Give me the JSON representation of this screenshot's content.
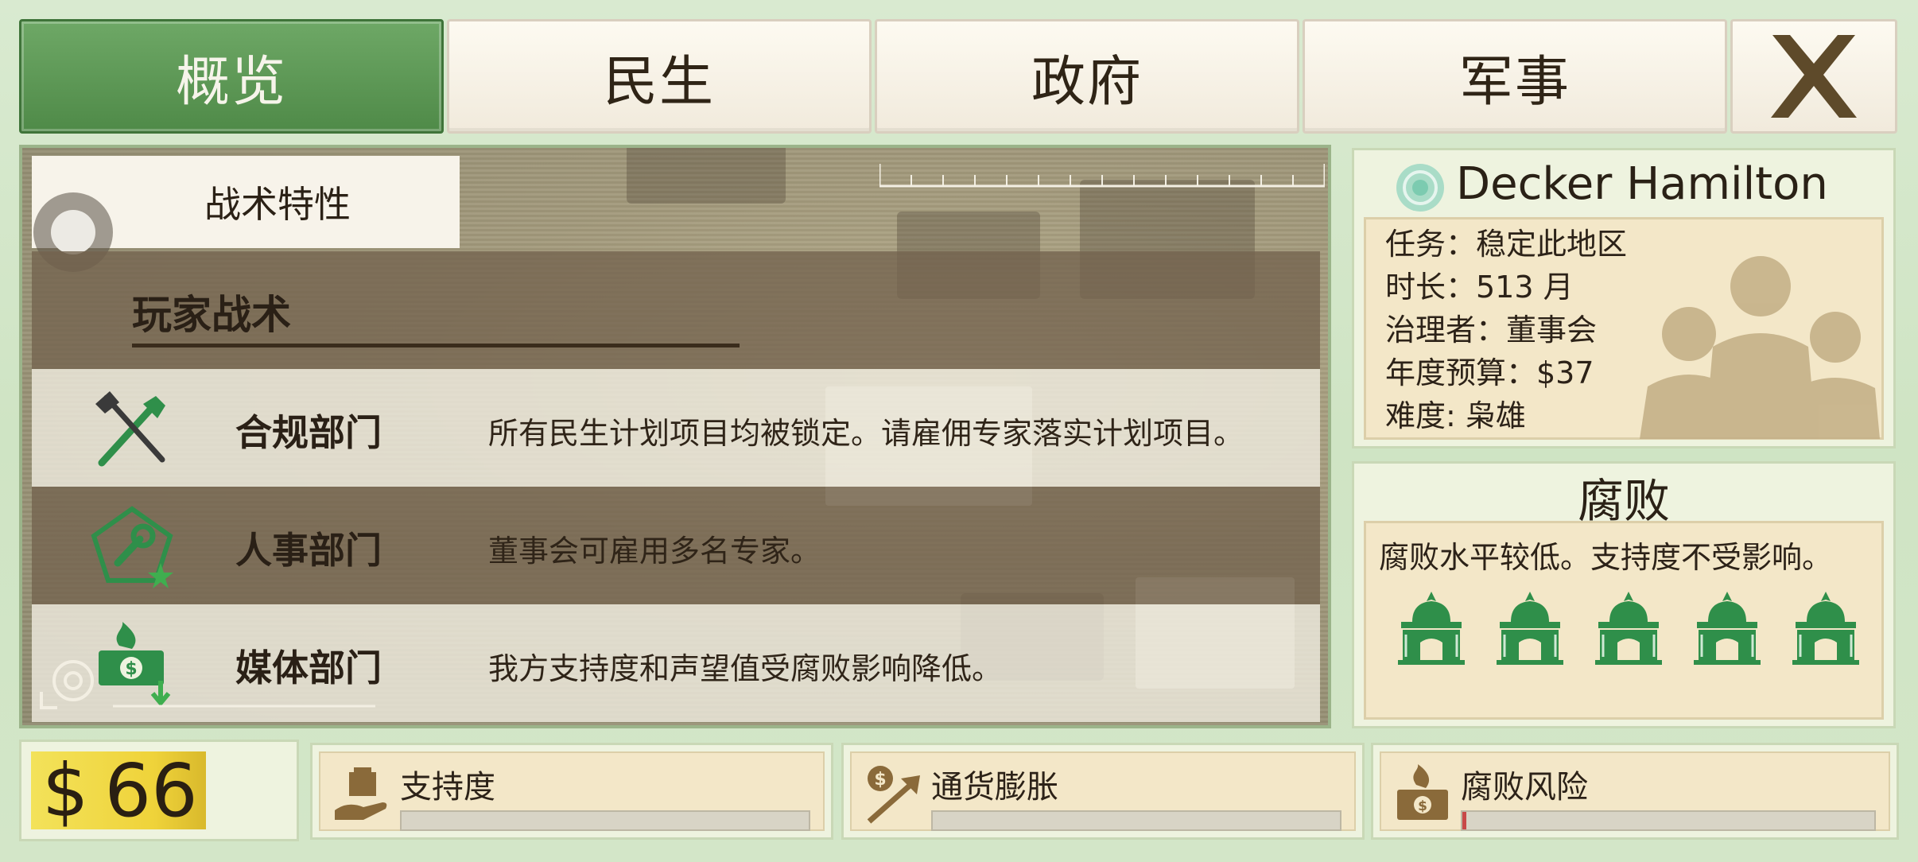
{
  "tabs": [
    {
      "label": "概览",
      "active": true
    },
    {
      "label": "民生",
      "active": false
    },
    {
      "label": "政府",
      "active": false
    },
    {
      "label": "军事",
      "active": false
    }
  ],
  "close_icon": "close-x-icon",
  "traits": {
    "sub_tab_label": "战术特性",
    "section_title": "玩家战术",
    "rows": [
      {
        "icon": "tools-cross-icon",
        "name": "合规部门",
        "desc": "所有民生计划项目均被锁定。请雇佣专家落实计划项目。"
      },
      {
        "icon": "wrench-pentagon-icon",
        "name": "人事部门",
        "desc": "董事会可雇用多名专家。"
      },
      {
        "icon": "money-burn-icon",
        "name": "媒体部门",
        "desc": "我方支持度和声望值受腐败影响降低。"
      }
    ]
  },
  "profile": {
    "name": "Decker Hamilton",
    "mission": "任务：稳定此地区",
    "duration": "时长：513 月",
    "governor": "治理者：董事会",
    "budget": "年度预算：$37",
    "difficulty": "难度: 枭雄"
  },
  "corruption": {
    "title": "腐败",
    "text": "腐败水平较低。支持度不受影响。",
    "icon_count": 5,
    "color": "#2f8f4a"
  },
  "money": {
    "symbol": "$",
    "amount": "66"
  },
  "stats": [
    {
      "label": "支持度",
      "icon": "support-hand-icon",
      "level": 0.0
    },
    {
      "label": "通货膨胀",
      "icon": "inflation-arrow-icon",
      "level": 0.0
    },
    {
      "label": "腐败风险",
      "icon": "corruption-risk-icon",
      "level": 0.01
    }
  ]
}
